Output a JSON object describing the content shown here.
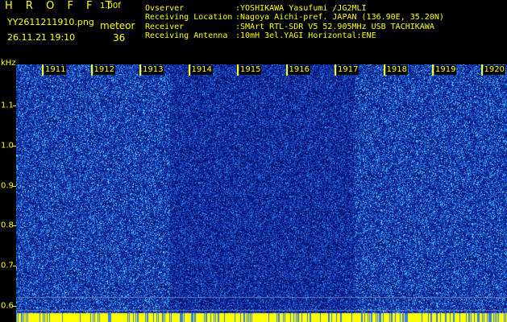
{
  "header": {
    "brand": "H R O F F T",
    "version": "1.00f",
    "filename": "YY2611211910.png",
    "mode": "meteor",
    "datetime": "26.11.21 19:10",
    "meteor_count": "36"
  },
  "station": [
    {
      "key": "Ovserver",
      "value": ":YOSHIKAWA Yasufumi /JG2MLI"
    },
    {
      "key": "Receiving Location",
      "value": ":Nagoya Aichi-pref. JAPAN (136.90E, 35.20N)"
    },
    {
      "key": "Receiver",
      "value": ":SMArt RTL-SDR V5 52.905MHz USB TACHIKAWA"
    },
    {
      "key": "Receiving Antenna",
      "value": ":10mH 3el.YAGI Horizontal:ENE"
    }
  ],
  "chart_data": {
    "type": "heatmap",
    "ylabel": "kHz",
    "ytick_labels": [
      "1.1",
      "1.0",
      "0.9",
      "0.8",
      "0.7",
      "0.6"
    ],
    "yticks": [
      1.1,
      1.0,
      0.9,
      0.8,
      0.7,
      0.6
    ],
    "ylim": [
      0.57,
      1.2
    ],
    "xtick_labels": [
      "1911",
      "1912",
      "1913",
      "1914",
      "1915",
      "1916",
      "1917",
      "1918",
      "1919",
      "1920"
    ],
    "colors": {
      "noise_dark": "#0a1a8c",
      "noise_mid": "#1e5adc",
      "noise_light": "#50c8ff",
      "axis": "#ffff00"
    }
  }
}
